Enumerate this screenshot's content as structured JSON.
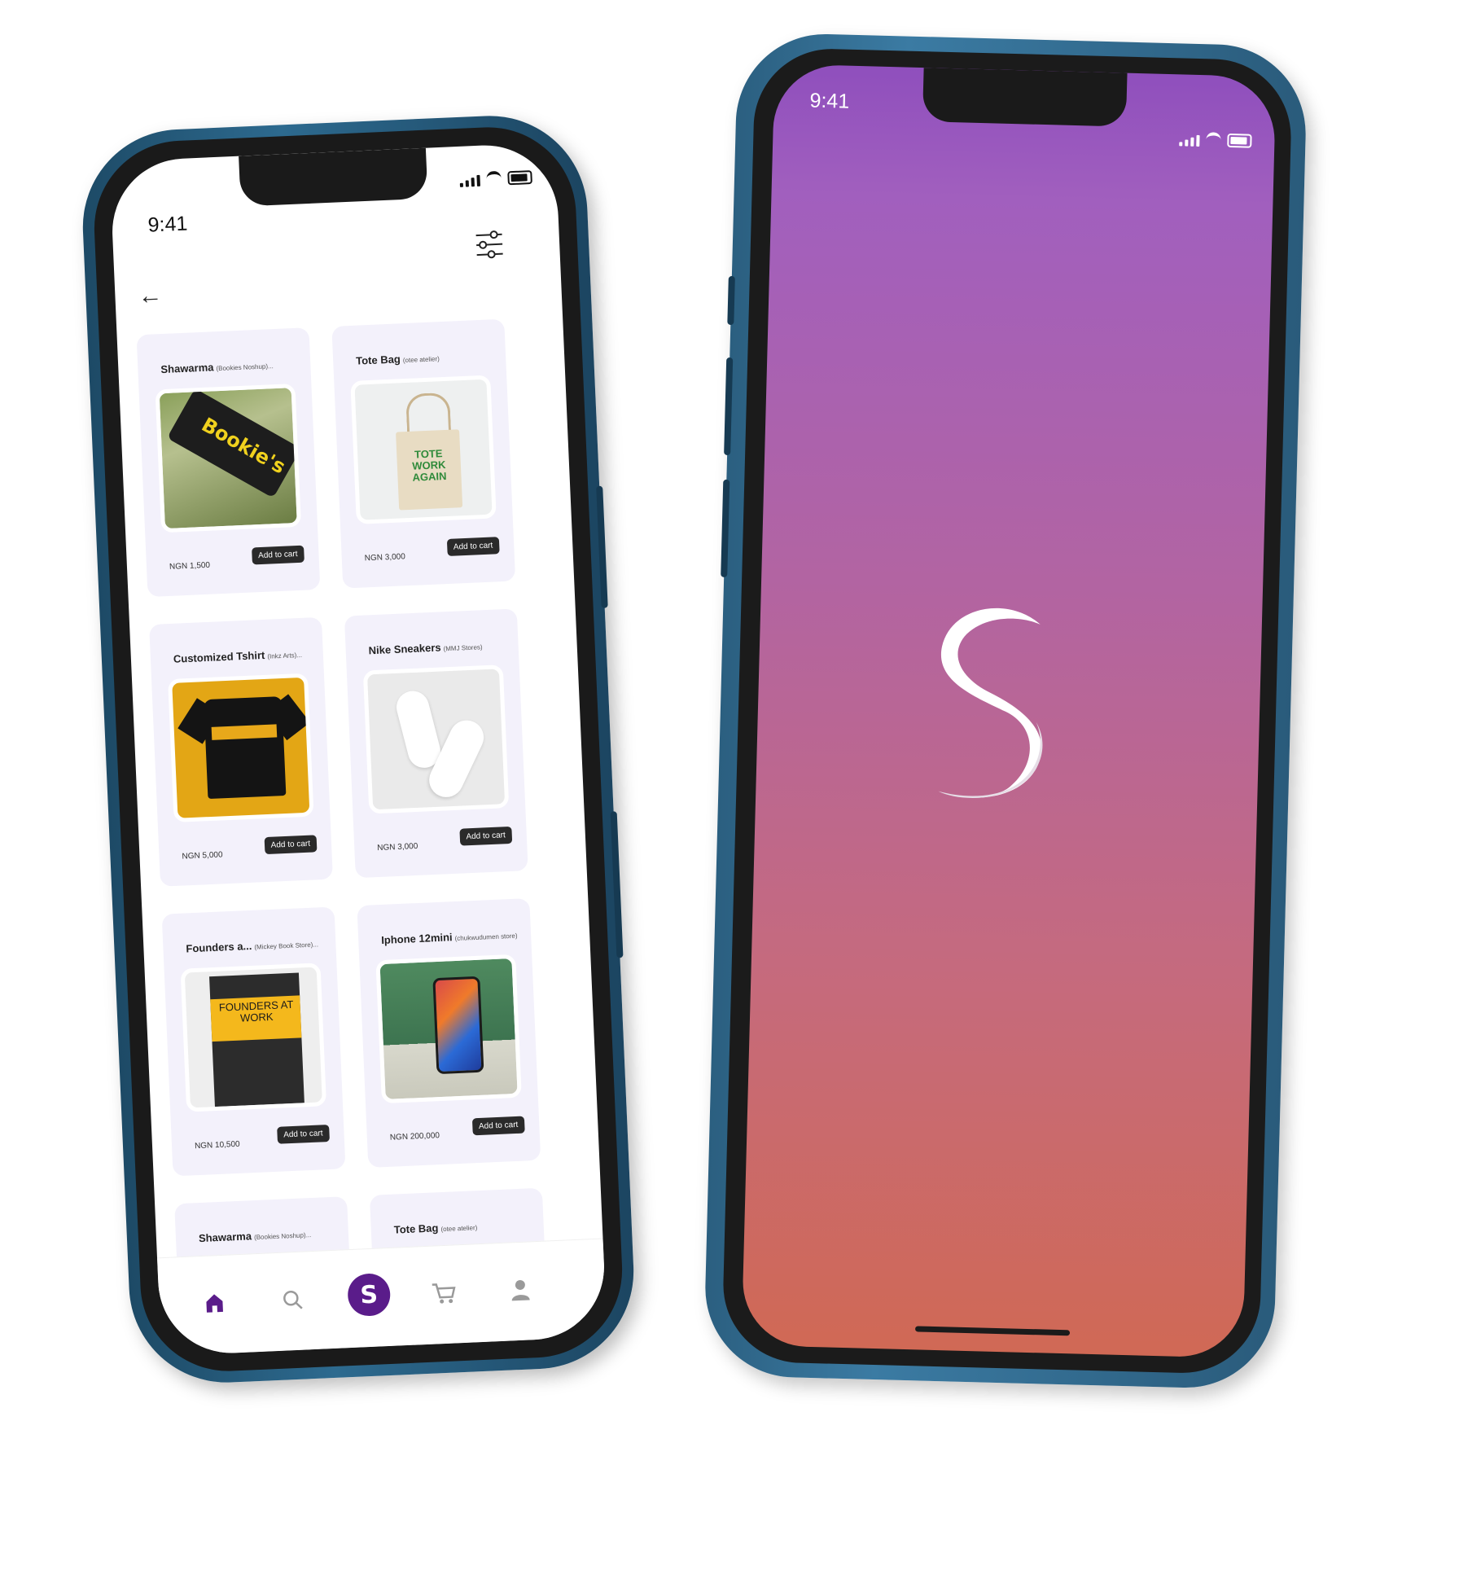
{
  "left_phone": {
    "status_time": "9:41",
    "products": [
      {
        "name": "Shawarma",
        "vendor": "(Bookies Noshup)...",
        "price": "NGN 1,500",
        "button": "Add to cart",
        "image_text": "Bookie's"
      },
      {
        "name": "Tote Bag",
        "vendor": "(otee atelier)",
        "price": "NGN 3,000",
        "button": "Add to cart",
        "image_text": "TOTE WORK AGAIN"
      },
      {
        "name": "Customized Tshirt",
        "vendor": "(Inkz Arts)...",
        "price": "NGN 5,000",
        "button": "Add to cart"
      },
      {
        "name": "Nike Sneakers",
        "vendor": "(MMJ Stores)",
        "price": "NGN 3,000",
        "button": "Add to cart"
      },
      {
        "name": "Founders a...",
        "vendor": "(Mickey Book Store)...",
        "price": "NGN 10,500",
        "button": "Add to cart",
        "image_text": "FOUNDERS AT WORK"
      },
      {
        "name": "Iphone 12mini",
        "vendor": "(chukwudumen store)",
        "price": "NGN 200,000",
        "button": "Add to cart"
      },
      {
        "name": "Shawarma",
        "vendor": "(Bookies Noshup)..."
      },
      {
        "name": "Tote Bag",
        "vendor": "(otee atelier)"
      }
    ],
    "nav": {
      "items": [
        "home-icon",
        "search-icon",
        "brand-logo",
        "cart-icon",
        "profile-icon"
      ],
      "brand_letter": "S",
      "active": "home",
      "active_color": "#5a1c8a"
    }
  },
  "right_phone": {
    "status_time": "9:41",
    "gradient": [
      "#8f4fbd",
      "#d06955"
    ]
  },
  "colors": {
    "brand": "#5a1c8a",
    "card_bg": "#f3f1fb",
    "button_bg": "#2a2a2a",
    "phone_frame": "#2d6a8f"
  }
}
